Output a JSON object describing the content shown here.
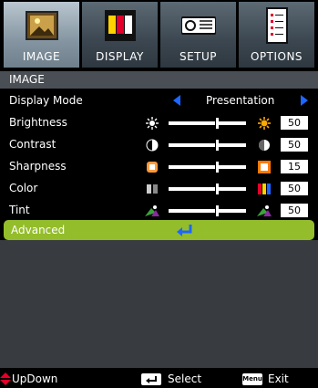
{
  "tabs": [
    {
      "label": "IMAGE",
      "icon": "image-icon"
    },
    {
      "label": "DISPLAY",
      "icon": "display-icon"
    },
    {
      "label": "SETUP",
      "icon": "projector-icon"
    },
    {
      "label": "OPTIONS",
      "icon": "options-icon"
    }
  ],
  "section_title": "IMAGE",
  "rows": {
    "display_mode": {
      "label": "Display Mode",
      "value": "Presentation"
    },
    "brightness": {
      "label": "Brightness",
      "value": "50"
    },
    "contrast": {
      "label": "Contrast",
      "value": "50"
    },
    "sharpness": {
      "label": "Sharpness",
      "value": "15"
    },
    "color": {
      "label": "Color",
      "value": "50"
    },
    "tint": {
      "label": "Tint",
      "value": "50"
    }
  },
  "advanced": {
    "label": "Advanced"
  },
  "footer": {
    "updown": "UpDown",
    "select": "Select",
    "menu_key": "Menu",
    "exit": "Exit"
  },
  "colors": {
    "accent": "#93bd2a",
    "arrow": "#1e66ff",
    "panel": "#383c40"
  }
}
